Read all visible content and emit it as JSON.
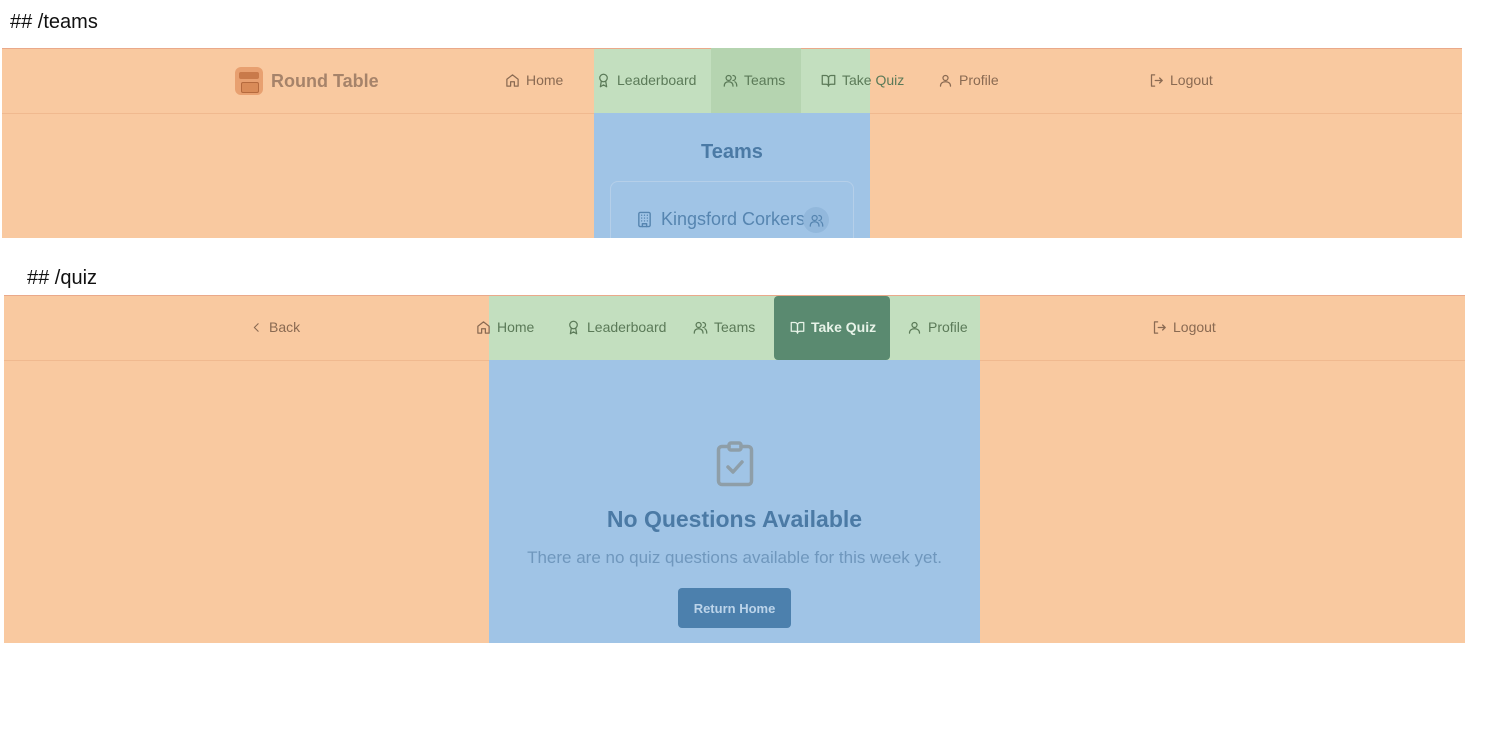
{
  "sections": {
    "teams_heading": "## /teams",
    "quiz_heading": "## /quiz"
  },
  "teams_page": {
    "brand": "Round Table",
    "nav": {
      "home": "Home",
      "leaderboard": "Leaderboard",
      "teams": "Teams",
      "take_quiz": "Take Quiz",
      "profile": "Profile",
      "logout": "Logout"
    },
    "active_tab": "Teams",
    "title": "Teams",
    "team_name": "Kingsford Corkers"
  },
  "quiz_page": {
    "back": "Back",
    "nav": {
      "home": "Home",
      "leaderboard": "Leaderboard",
      "teams": "Teams",
      "take_quiz": "Take Quiz",
      "profile": "Profile",
      "logout": "Logout"
    },
    "active_tab": "Take Quiz",
    "empty_title": "No Questions Available",
    "empty_text": "There are no quiz questions available for this week yet.",
    "return_button": "Return Home"
  },
  "colors": {
    "region_orange": "#f9c9a0",
    "region_green": "#c3dfbf",
    "region_blue": "#a0c4e6",
    "active_dark": "#5a8a70",
    "button": "#4c80ad"
  },
  "icons": {
    "home": "home-icon",
    "leaderboard": "award-icon",
    "teams": "users-icon",
    "take_quiz": "book-open-icon",
    "profile": "user-icon",
    "logout": "logout-icon",
    "back": "chevron-left-icon",
    "team": "building-icon",
    "empty": "clipboard-check-icon"
  }
}
